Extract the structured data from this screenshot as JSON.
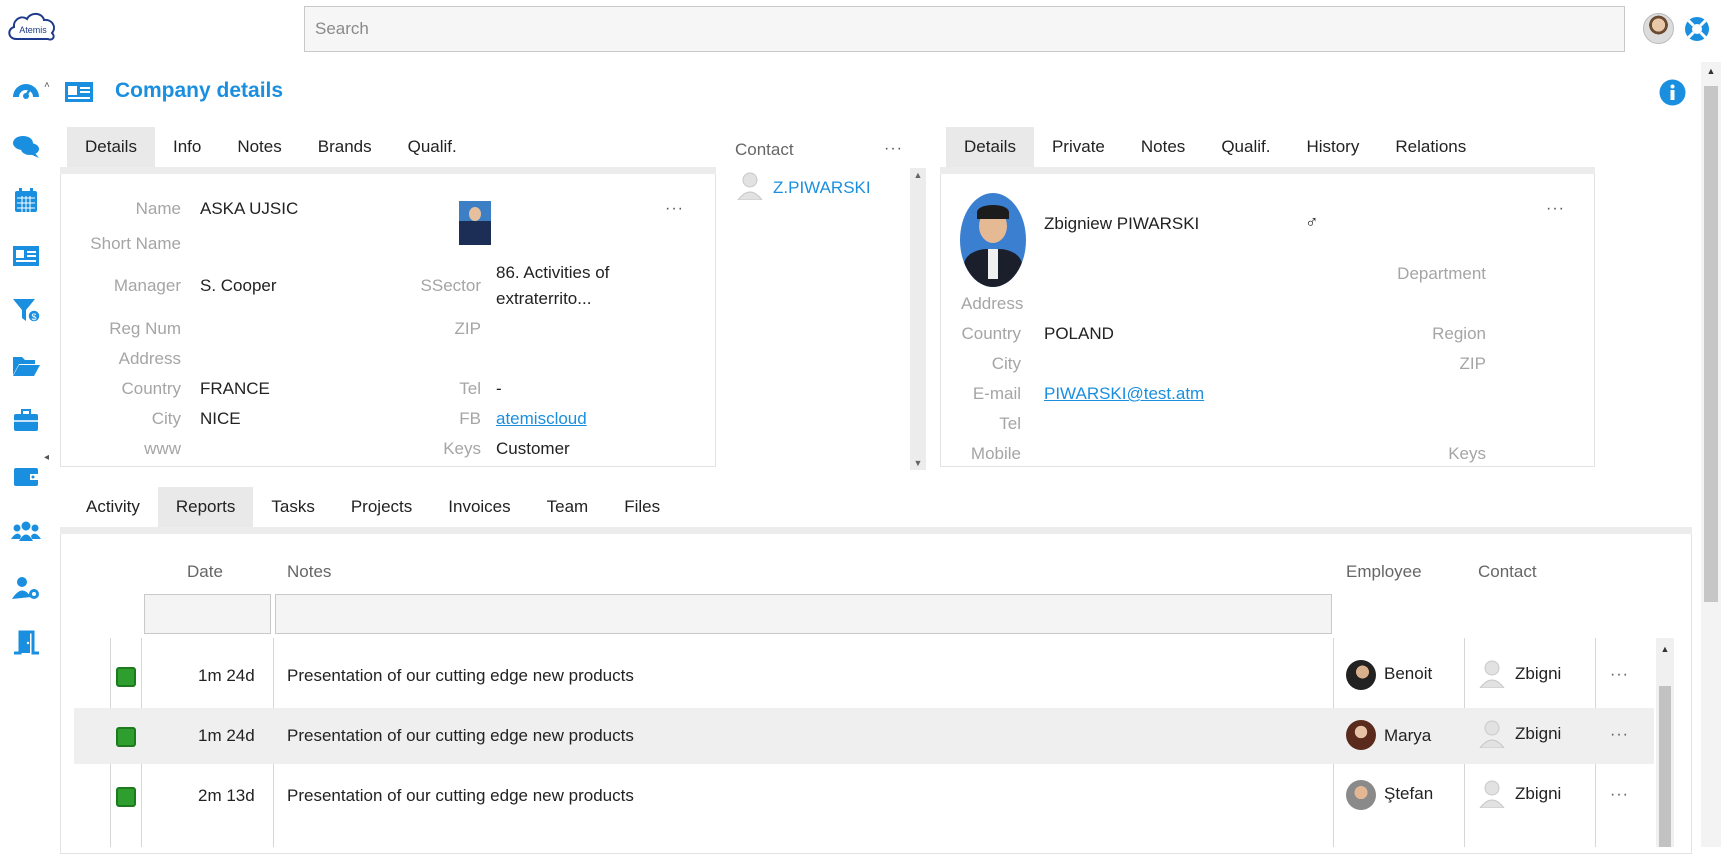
{
  "brand": {
    "logo_text": "Atemis"
  },
  "search": {
    "placeholder": "Search"
  },
  "sidebar": {
    "items": [
      "dashboard-icon",
      "chat-icon",
      "calendar-icon",
      "id-card-icon",
      "funnel-icon",
      "folder-icon",
      "briefcase-icon",
      "wallet-icon",
      "team-icon",
      "user-settings-icon",
      "exit-icon"
    ]
  },
  "header": {
    "title": "Company details"
  },
  "company_tabs": [
    "Details",
    "Info",
    "Notes",
    "Brands",
    "Qualif."
  ],
  "company": {
    "labels": {
      "name": "Name",
      "short_name": "Short Name",
      "manager": "Manager",
      "reg_num": "Reg Num",
      "address": "Address",
      "country": "Country",
      "city": "City",
      "www": "www",
      "ssector": "SSector",
      "zip": "ZIP",
      "tel": "Tel",
      "fb": "FB",
      "keys": "Keys"
    },
    "name": "ASKA UJSIC",
    "manager": "S. Cooper",
    "ssector_line1": "86. Activities of",
    "ssector_line2": "extraterrito...",
    "country": "FRANCE",
    "city": "NICE",
    "tel": "-",
    "fb": "atemiscloud",
    "keys": "Customer",
    "menu": "···"
  },
  "contact_column": {
    "header": "Contact",
    "menu": "···",
    "items": [
      "Z.PIWARSKI"
    ]
  },
  "contact_tabs": [
    "Details",
    "Private",
    "Notes",
    "Qualif.",
    "History",
    "Relations"
  ],
  "contact": {
    "name": "Zbigniew PIWARSKI",
    "gender": "♂",
    "menu": "···",
    "labels": {
      "department": "Department",
      "address": "Address",
      "country": "Country",
      "region": "Region",
      "city": "City",
      "zip": "ZIP",
      "email": "E-mail",
      "tel": "Tel",
      "mobile": "Mobile",
      "keys": "Keys"
    },
    "country": "POLAND",
    "email": "PIWARSKI@test.atm"
  },
  "bottom_tabs": [
    "Activity",
    "Reports",
    "Tasks",
    "Projects",
    "Invoices",
    "Team",
    "Files"
  ],
  "grid": {
    "columns": {
      "date": "Date",
      "notes": "Notes",
      "employee": "Employee",
      "contact": "Contact"
    },
    "rows": [
      {
        "date": "1m 24d",
        "notes": "Presentation of our cutting edge new products",
        "employee": "Benoit",
        "contact": "Zbigni",
        "menu": "···"
      },
      {
        "date": "1m 24d",
        "notes": "Presentation of our cutting edge new products",
        "employee": "Marya",
        "contact": "Zbigni",
        "menu": "···"
      },
      {
        "date": "2m 13d",
        "notes": "Presentation of our cutting edge new products",
        "employee": "Ştefan",
        "contact": "Zbigni",
        "menu": "···"
      }
    ]
  },
  "colors": {
    "accent": "#1a8fe0",
    "phone_green": "#2e9e2e"
  }
}
